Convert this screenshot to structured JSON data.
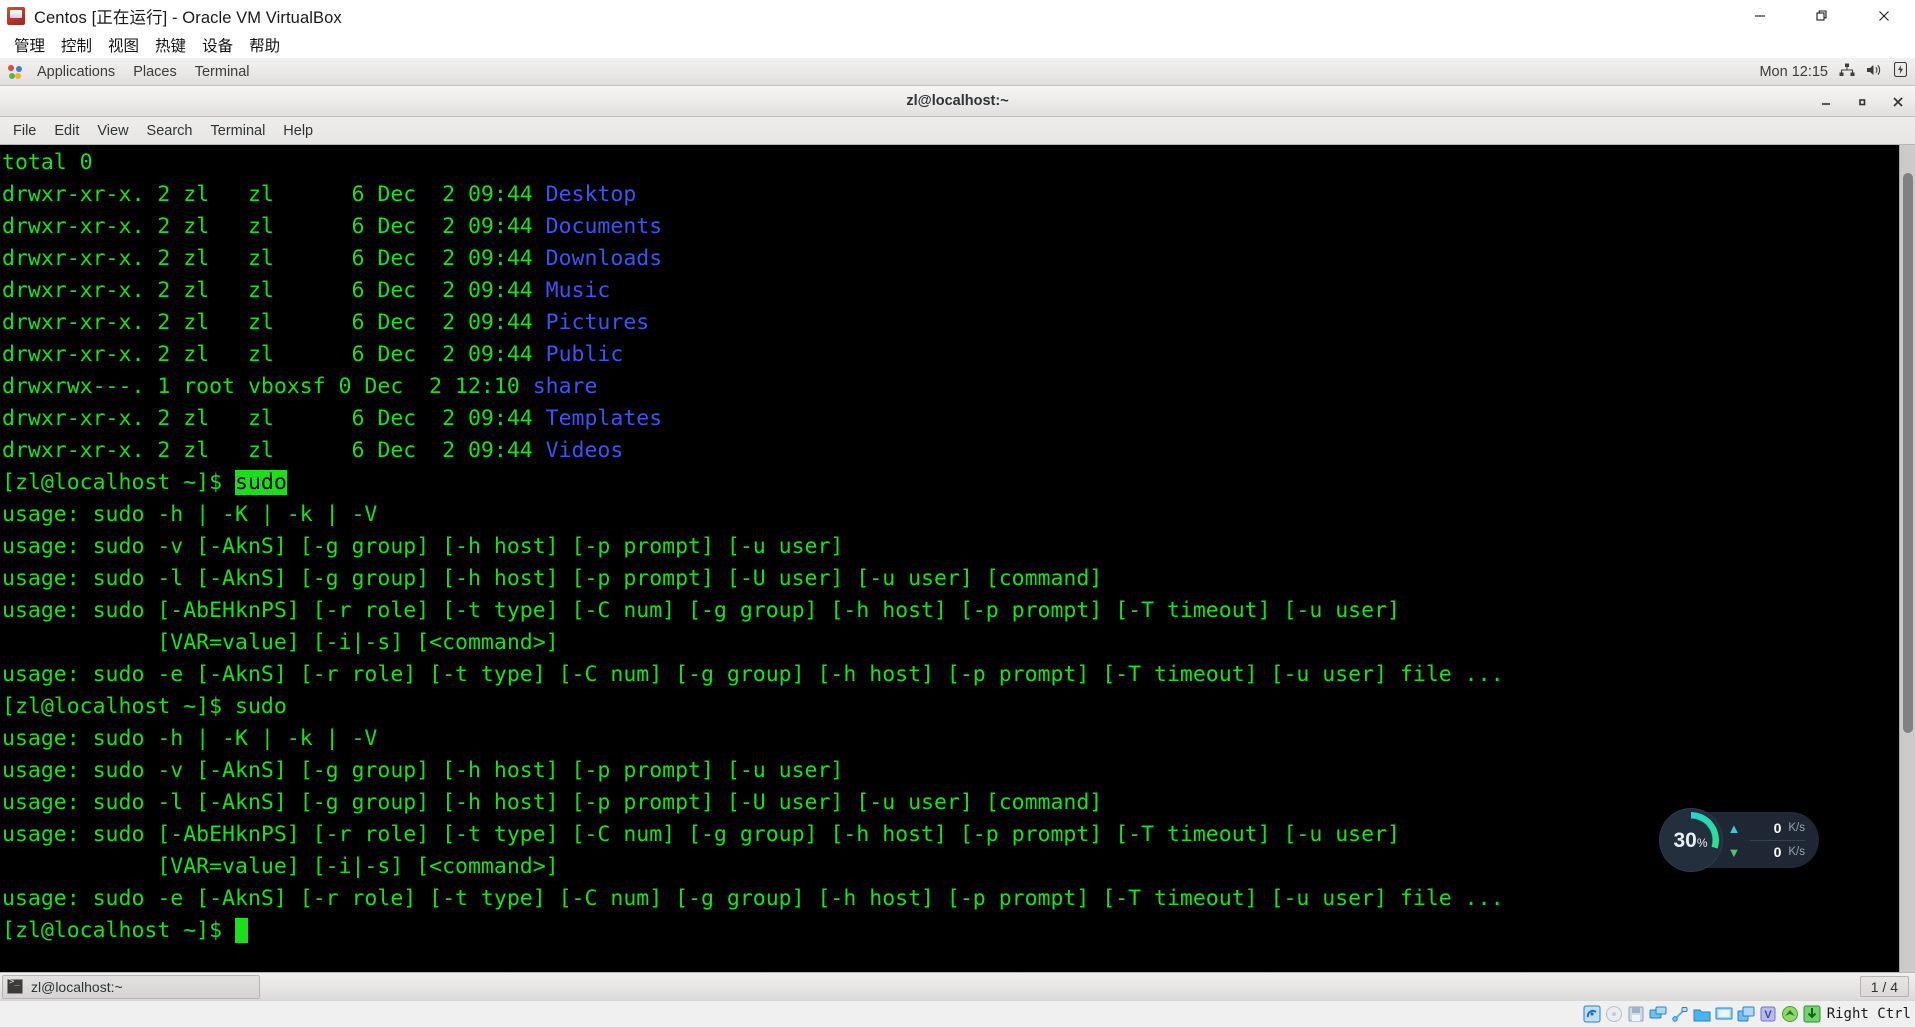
{
  "vbox": {
    "title": "Centos [正在运行] - Oracle VM VirtualBox",
    "app_icon": "virtualbox-icon",
    "menu": [
      "管理",
      "控制",
      "视图",
      "热键",
      "设备",
      "帮助"
    ],
    "window_buttons": {
      "minimize": "—",
      "restore": "❐",
      "close": "✕"
    },
    "statusbar": {
      "host_key": "Right Ctrl",
      "icons": [
        {
          "name": "hard-disk-icon",
          "color": "#2a7fd4"
        },
        {
          "name": "optical-disk-icon",
          "color": "#c8cdd2"
        },
        {
          "name": "floppy-disk-icon",
          "color": "#8fa3b8"
        },
        {
          "name": "network-icon",
          "color": "#3f9ae0"
        },
        {
          "name": "usb-icon",
          "color": "#7fc3f0"
        },
        {
          "name": "shared-folder-icon",
          "color": "#38a0e8"
        },
        {
          "name": "display-icon",
          "color": "#4fb0ec"
        },
        {
          "name": "recording-icon",
          "color": "#3d9ee6"
        },
        {
          "name": "virtualization-icon",
          "color": "#7e86d6"
        },
        {
          "name": "mouse-integration-icon",
          "color": "#4fc24f"
        },
        {
          "name": "host-key-icon",
          "color": "#3fb93f"
        }
      ]
    }
  },
  "gnome": {
    "panel": {
      "applications": "Applications",
      "places": "Places",
      "terminal": "Terminal",
      "clock": "Mon 12:15",
      "tray": [
        "network-icon",
        "volume-icon",
        "battery-icon"
      ]
    },
    "taskbar": {
      "task_label": "zl@localhost:~",
      "task_icon": "terminal-icon",
      "workspace": "1 / 4"
    }
  },
  "terminal": {
    "title": "zl@localhost:~",
    "menu": [
      "File",
      "Edit",
      "View",
      "Search",
      "Terminal",
      "Help"
    ],
    "window_buttons": {
      "minimize": "—",
      "maximize": "□",
      "close": "✕"
    },
    "colors": {
      "background": "#000000",
      "foreground": "#19e019",
      "directory": "#3b55f0",
      "selection_bg": "#19e019",
      "selection_fg": "#000000"
    },
    "lines": [
      [
        {
          "t": "total 0",
          "c": "green"
        }
      ],
      [
        {
          "t": "drwxr-xr-x. 2 zl   zl      6 Dec  2 09:44 ",
          "c": "green"
        },
        {
          "t": "Desktop",
          "c": "dir"
        }
      ],
      [
        {
          "t": "drwxr-xr-x. 2 zl   zl      6 Dec  2 09:44 ",
          "c": "green"
        },
        {
          "t": "Documents",
          "c": "dir"
        }
      ],
      [
        {
          "t": "drwxr-xr-x. 2 zl   zl      6 Dec  2 09:44 ",
          "c": "green"
        },
        {
          "t": "Downloads",
          "c": "dir"
        }
      ],
      [
        {
          "t": "drwxr-xr-x. 2 zl   zl      6 Dec  2 09:44 ",
          "c": "green"
        },
        {
          "t": "Music",
          "c": "dir"
        }
      ],
      [
        {
          "t": "drwxr-xr-x. 2 zl   zl      6 Dec  2 09:44 ",
          "c": "green"
        },
        {
          "t": "Pictures",
          "c": "dir"
        }
      ],
      [
        {
          "t": "drwxr-xr-x. 2 zl   zl      6 Dec  2 09:44 ",
          "c": "green"
        },
        {
          "t": "Public",
          "c": "dir"
        }
      ],
      [
        {
          "t": "drwxrwx---. 1 root vboxsf 0 Dec  2 12:10 ",
          "c": "green"
        },
        {
          "t": "share",
          "c": "dir"
        }
      ],
      [
        {
          "t": "drwxr-xr-x. 2 zl   zl      6 Dec  2 09:44 ",
          "c": "green"
        },
        {
          "t": "Templates",
          "c": "dir"
        }
      ],
      [
        {
          "t": "drwxr-xr-x. 2 zl   zl      6 Dec  2 09:44 ",
          "c": "green"
        },
        {
          "t": "Videos",
          "c": "dir"
        }
      ],
      [
        {
          "t": "[zl@localhost ~]$ ",
          "c": "green"
        },
        {
          "t": "sudo",
          "c": "sel"
        }
      ],
      [
        {
          "t": "usage: sudo -h | -K | -k | -V",
          "c": "green"
        }
      ],
      [
        {
          "t": "usage: sudo -v [-AknS] [-g group] [-h host] [-p prompt] [-u user]",
          "c": "green"
        }
      ],
      [
        {
          "t": "usage: sudo -l [-AknS] [-g group] [-h host] [-p prompt] [-U user] [-u user] [command]",
          "c": "green"
        }
      ],
      [
        {
          "t": "usage: sudo [-AbEHknPS] [-r role] [-t type] [-C num] [-g group] [-h host] [-p prompt] [-T timeout] [-u user]",
          "c": "green"
        }
      ],
      [
        {
          "t": "            [VAR=value] [-i|-s] [<command>]",
          "c": "green"
        }
      ],
      [
        {
          "t": "usage: sudo -e [-AknS] [-r role] [-t type] [-C num] [-g group] [-h host] [-p prompt] [-T timeout] [-u user] file ...",
          "c": "green"
        }
      ],
      [
        {
          "t": "[zl@localhost ~]$ sudo",
          "c": "green"
        }
      ],
      [
        {
          "t": "usage: sudo -h | -K | -k | -V",
          "c": "green"
        }
      ],
      [
        {
          "t": "usage: sudo -v [-AknS] [-g group] [-h host] [-p prompt] [-u user]",
          "c": "green"
        }
      ],
      [
        {
          "t": "usage: sudo -l [-AknS] [-g group] [-h host] [-p prompt] [-U user] [-u user] [command]",
          "c": "green"
        }
      ],
      [
        {
          "t": "usage: sudo [-AbEHknPS] [-r role] [-t type] [-C num] [-g group] [-h host] [-p prompt] [-T timeout] [-u user]",
          "c": "green"
        }
      ],
      [
        {
          "t": "            [VAR=value] [-i|-s] [<command>]",
          "c": "green"
        }
      ],
      [
        {
          "t": "usage: sudo -e [-AknS] [-r role] [-t type] [-C num] [-g group] [-h host] [-p prompt] [-T timeout] [-u user] file ...",
          "c": "green"
        }
      ],
      [
        {
          "t": "[zl@localhost ~]$ ",
          "c": "green"
        },
        {
          "t": " ",
          "c": "cursor"
        }
      ]
    ]
  },
  "speed_widget": {
    "gauge_value": "30",
    "gauge_unit": "%",
    "gauge_percent": 30,
    "upload": {
      "arrow": "⬆",
      "value": "0",
      "unit": "K/s"
    },
    "download": {
      "arrow": "⬇",
      "value": "0",
      "unit": "K/s"
    },
    "colors": {
      "arc_start": "#23d6d0",
      "arc_end": "#2ee08a",
      "bg": "#1e2733"
    }
  }
}
